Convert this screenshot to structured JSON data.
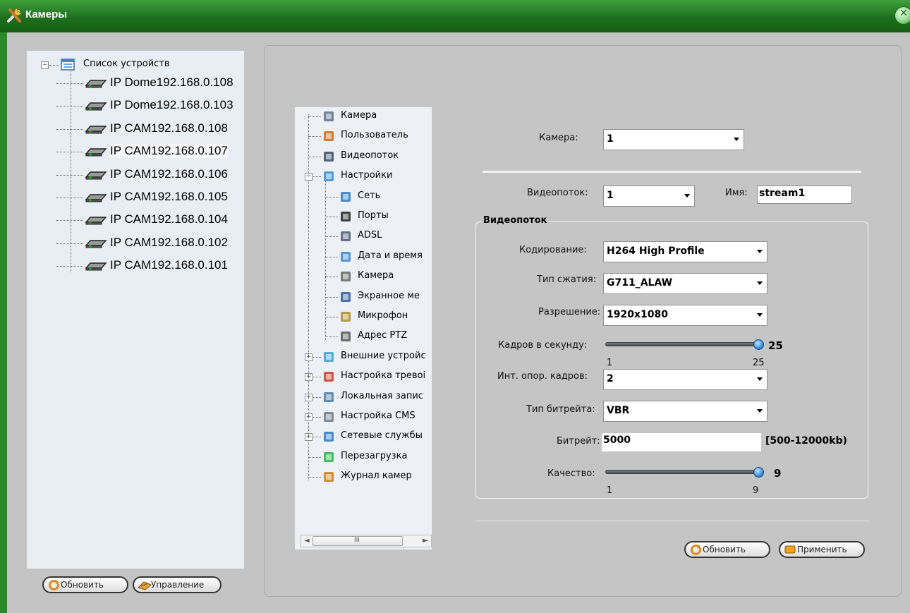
{
  "window": {
    "title": "Камеры"
  },
  "devices": {
    "root_label": "Список устройств",
    "items": [
      {
        "label": "IP Dome192.168.0.108"
      },
      {
        "label": "IP Dome192.168.0.103"
      },
      {
        "label": "IP CAM192.168.0.108"
      },
      {
        "label": "IP CAM192.168.0.107"
      },
      {
        "label": "IP CAM192.168.0.106"
      },
      {
        "label": "IP CAM192.168.0.105"
      },
      {
        "label": "IP CAM192.168.0.104"
      },
      {
        "label": "IP CAM192.168.0.102"
      },
      {
        "label": "IP CAM192.168.0.101"
      }
    ],
    "selected_index": 3,
    "refresh_label": "Обновить",
    "manage_label": "Управление"
  },
  "settings_tree": {
    "items": [
      {
        "label": "Камера",
        "icon": "document-icon"
      },
      {
        "label": "Пользователь",
        "icon": "users-icon"
      },
      {
        "label": "Видеопоток",
        "icon": "equalizer-icon"
      },
      {
        "label": "Настройки",
        "icon": "tools-icon"
      },
      {
        "label": "Сеть",
        "icon": "network-icon"
      },
      {
        "label": "Порты",
        "icon": "port-icon"
      },
      {
        "label": "ADSL",
        "icon": "adsl-icon"
      },
      {
        "label": "Дата и время",
        "icon": "calendar-icon"
      },
      {
        "label": "Камера",
        "icon": "camera-icon"
      },
      {
        "label": "Экранное ме",
        "icon": "osd-icon"
      },
      {
        "label": "Микрофон",
        "icon": "microphone-icon"
      },
      {
        "label": "Адрес PTZ",
        "icon": "ptz-icon"
      },
      {
        "label": "Внешние устройс",
        "icon": "external-devices-icon"
      },
      {
        "label": "Настройка тревоі",
        "icon": "alarm-icon"
      },
      {
        "label": "Локальная запис",
        "icon": "local-record-icon"
      },
      {
        "label": "Настройка CMS",
        "icon": "cms-icon"
      },
      {
        "label": "Сетевые службы",
        "icon": "network-services-icon"
      },
      {
        "label": "Перезагрузка",
        "icon": "reboot-icon"
      },
      {
        "label": "Журнал камер",
        "icon": "log-icon"
      }
    ],
    "scroll_grip": "III"
  },
  "form": {
    "camera_label": "Камера:",
    "camera_value": "1",
    "stream_label": "Видеопоток:",
    "stream_value": "1",
    "name_label": "Имя:",
    "name_value": "stream1",
    "group_title": "Видеопоток",
    "encoding_label": "Кодирование:",
    "encoding_value": "H264 High Profile",
    "compression_label": "Тип сжатия:",
    "compression_value": "G711_ALAW",
    "resolution_label": "Разрешение:",
    "resolution_value": "1920x1080",
    "fps_label": "Кадров в секунду:",
    "fps_value": "25",
    "fps_min": "1",
    "fps_max": "25",
    "fps_level": 1.0,
    "iframe_label": "Инт. опор. кадров:",
    "iframe_value": "2",
    "bitrate_type_label": "Тип битрейта:",
    "bitrate_type_value": "VBR",
    "bitrate_label": "Битрейт:",
    "bitrate_value": "5000",
    "bitrate_range": "[500-12000kb)",
    "quality_label": "Качество:",
    "quality_value": "9",
    "quality_min": "1",
    "quality_max": "9",
    "quality_level": 1.0,
    "refresh_label": "Обновить",
    "apply_label": "Применить"
  },
  "colors": {
    "title_bar": "#1d6f1d",
    "panel": "#c5c5c5",
    "tree_bg": "#e9eef4"
  }
}
